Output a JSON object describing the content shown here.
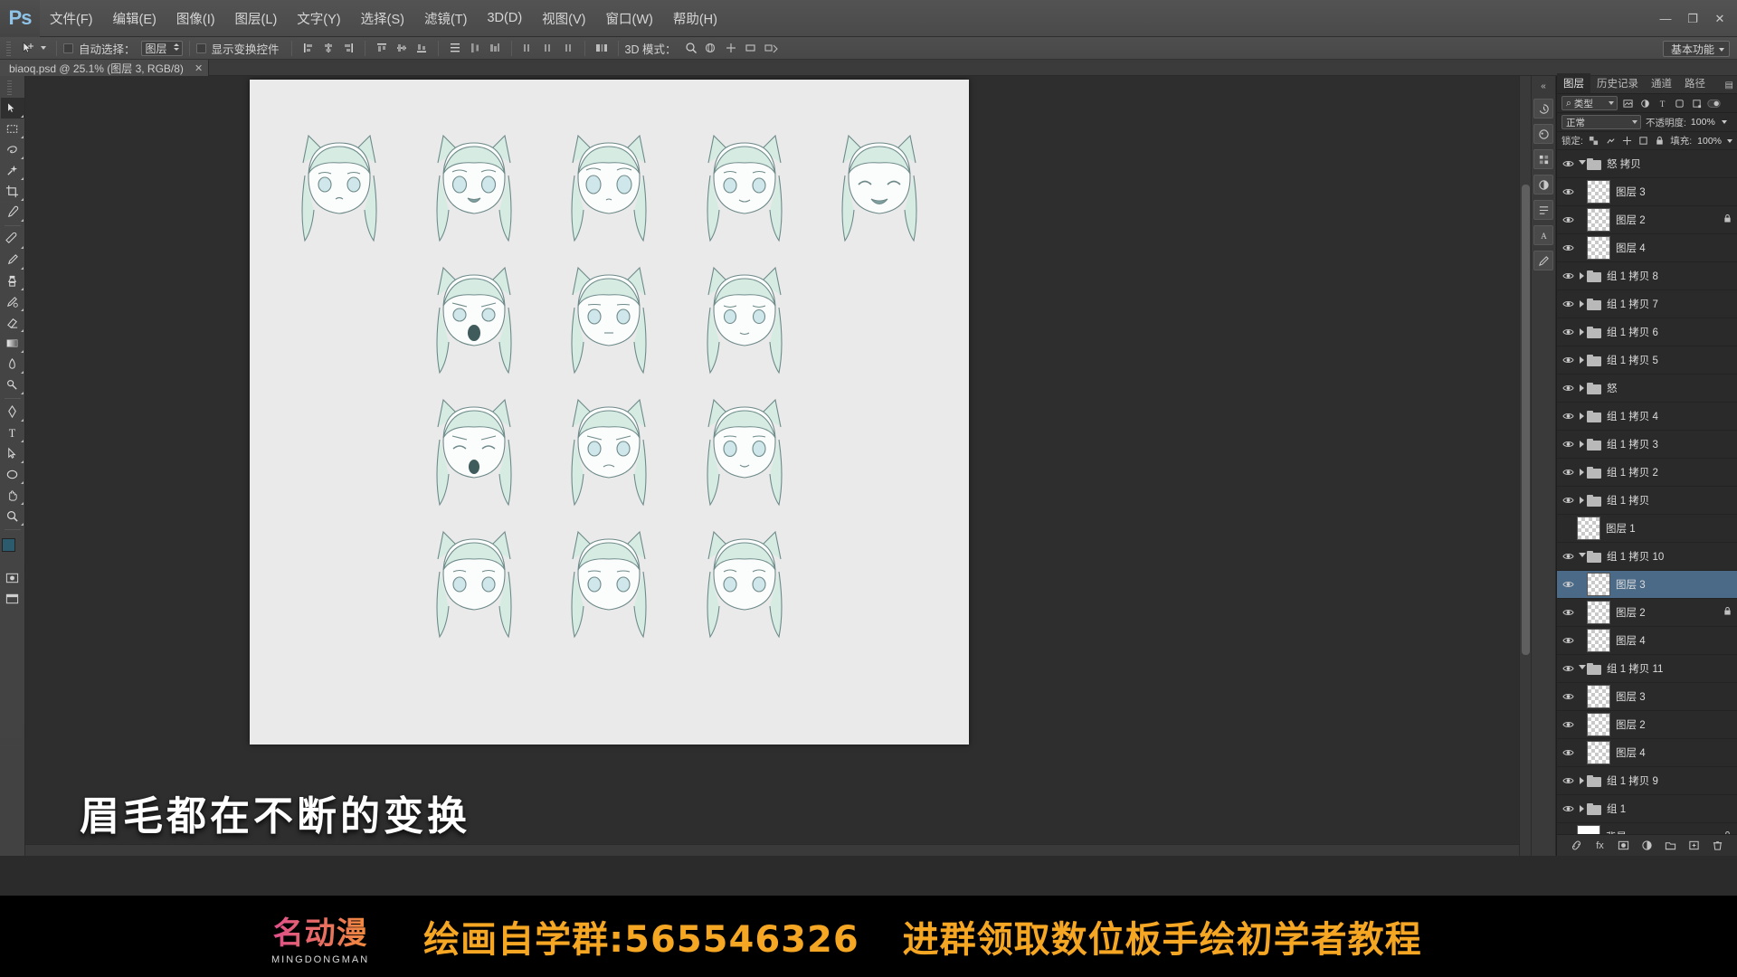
{
  "app": {
    "name": "Ps",
    "logo_text": "Ps"
  },
  "menubar": {
    "items": [
      {
        "label": "文件(F)"
      },
      {
        "label": "编辑(E)"
      },
      {
        "label": "图像(I)"
      },
      {
        "label": "图层(L)"
      },
      {
        "label": "文字(Y)"
      },
      {
        "label": "选择(S)"
      },
      {
        "label": "滤镜(T)"
      },
      {
        "label": "3D(D)"
      },
      {
        "label": "视图(V)"
      },
      {
        "label": "窗口(W)"
      },
      {
        "label": "帮助(H)"
      }
    ],
    "window_controls": {
      "minimize": "—",
      "maximize": "❐",
      "close": "✕"
    }
  },
  "optionsbar": {
    "auto_select_label": "自动选择：",
    "auto_select_value": "图层",
    "show_transform_label": "显示变换控件",
    "mode_3d_label": "3D 模式：",
    "workspace": "基本功能"
  },
  "document": {
    "tab_title": "biaoq.psd @ 25.1% (图层 3, RGB/8)",
    "close_glyph": "✕",
    "zoom": "25.1%",
    "color_mode": "RGB/8",
    "active_layer": "图层 3"
  },
  "tools": {
    "items": [
      {
        "name": "move-tool",
        "glyph": "move",
        "active": false
      },
      {
        "name": "marquee-tool",
        "glyph": "marquee",
        "active": false
      },
      {
        "name": "lasso-tool",
        "glyph": "lasso",
        "active": false
      },
      {
        "name": "quick-selection-tool",
        "glyph": "wand",
        "active": false
      },
      {
        "name": "crop-tool",
        "glyph": "crop",
        "active": false
      },
      {
        "name": "eyedropper-tool",
        "glyph": "eyedropper",
        "active": false
      },
      {
        "name": "healing-brush-tool",
        "glyph": "heal",
        "active": false
      },
      {
        "name": "brush-tool",
        "glyph": "brush",
        "active": false
      },
      {
        "name": "clone-stamp-tool",
        "glyph": "stamp",
        "active": false
      },
      {
        "name": "history-brush-tool",
        "glyph": "history",
        "active": false
      },
      {
        "name": "eraser-tool",
        "glyph": "eraser",
        "active": false
      },
      {
        "name": "gradient-tool",
        "glyph": "gradient",
        "active": false
      },
      {
        "name": "blur-tool",
        "glyph": "blur",
        "active": false
      },
      {
        "name": "dodge-tool",
        "glyph": "dodge",
        "active": false
      },
      {
        "name": "pen-tool",
        "glyph": "pen",
        "active": false
      },
      {
        "name": "type-tool",
        "glyph": "T",
        "active": false
      },
      {
        "name": "path-selection-tool",
        "glyph": "pathsel",
        "active": false
      },
      {
        "name": "ellipse-tool",
        "glyph": "shape",
        "active": false
      },
      {
        "name": "hand-tool",
        "glyph": "hand",
        "active": false
      },
      {
        "name": "zoom-tool",
        "glyph": "zoom",
        "active": false
      }
    ],
    "foreground_color": "#2d5b6e",
    "background_color": "#e9e9e9"
  },
  "panels": {
    "tabs": [
      {
        "label": "图层",
        "active": true
      },
      {
        "label": "历史记录",
        "active": false
      },
      {
        "label": "通道",
        "active": false
      },
      {
        "label": "路径",
        "active": false
      }
    ],
    "menu_glyph": "▤",
    "filter": {
      "type_label": "类型",
      "search_glyph": "⌕"
    },
    "blend_mode": "正常",
    "opacity_label": "不透明度:",
    "opacity_value": "100%",
    "lock_label": "锁定:",
    "fill_label": "填充:",
    "fill_value": "100%"
  },
  "layers": [
    {
      "name": "怒 拷贝",
      "kind": "group",
      "visible": true,
      "expanded": true,
      "indent": 0,
      "locked": false,
      "selected": false
    },
    {
      "name": "图层 3",
      "kind": "pixel",
      "visible": true,
      "expanded": false,
      "indent": 1,
      "locked": false,
      "selected": false
    },
    {
      "name": "图层 2",
      "kind": "pixel",
      "visible": true,
      "expanded": false,
      "indent": 1,
      "locked": true,
      "selected": false
    },
    {
      "name": "图层 4",
      "kind": "pixel",
      "visible": true,
      "expanded": false,
      "indent": 1,
      "locked": false,
      "selected": false
    },
    {
      "name": "组 1 拷贝 8",
      "kind": "group",
      "visible": true,
      "expanded": false,
      "indent": 0,
      "locked": false,
      "selected": false
    },
    {
      "name": "组 1 拷贝 7",
      "kind": "group",
      "visible": true,
      "expanded": false,
      "indent": 0,
      "locked": false,
      "selected": false
    },
    {
      "name": "组 1 拷贝 6",
      "kind": "group",
      "visible": true,
      "expanded": false,
      "indent": 0,
      "locked": false,
      "selected": false
    },
    {
      "name": "组 1 拷贝 5",
      "kind": "group",
      "visible": true,
      "expanded": false,
      "indent": 0,
      "locked": false,
      "selected": false
    },
    {
      "name": "怒",
      "kind": "group",
      "visible": true,
      "expanded": false,
      "indent": 0,
      "locked": false,
      "selected": false
    },
    {
      "name": "组 1 拷贝 4",
      "kind": "group",
      "visible": true,
      "expanded": false,
      "indent": 0,
      "locked": false,
      "selected": false
    },
    {
      "name": "组 1 拷贝 3",
      "kind": "group",
      "visible": true,
      "expanded": false,
      "indent": 0,
      "locked": false,
      "selected": false
    },
    {
      "name": "组 1 拷贝 2",
      "kind": "group",
      "visible": true,
      "expanded": false,
      "indent": 0,
      "locked": false,
      "selected": false
    },
    {
      "name": "组 1 拷贝",
      "kind": "group",
      "visible": true,
      "expanded": false,
      "indent": 0,
      "locked": false,
      "selected": false
    },
    {
      "name": "图层 1",
      "kind": "pixel",
      "visible": false,
      "expanded": false,
      "indent": 0,
      "locked": false,
      "selected": false
    },
    {
      "name": "组 1 拷贝 10",
      "kind": "group",
      "visible": true,
      "expanded": true,
      "indent": 0,
      "locked": false,
      "selected": false
    },
    {
      "name": "图层 3",
      "kind": "pixel",
      "visible": true,
      "expanded": false,
      "indent": 1,
      "locked": false,
      "selected": true
    },
    {
      "name": "图层 2",
      "kind": "pixel",
      "visible": true,
      "expanded": false,
      "indent": 1,
      "locked": true,
      "selected": false
    },
    {
      "name": "图层 4",
      "kind": "pixel",
      "visible": true,
      "expanded": false,
      "indent": 1,
      "locked": false,
      "selected": false
    },
    {
      "name": "组 1 拷贝 11",
      "kind": "group",
      "visible": true,
      "expanded": true,
      "indent": 0,
      "locked": false,
      "selected": false
    },
    {
      "name": "图层 3",
      "kind": "pixel",
      "visible": true,
      "expanded": false,
      "indent": 1,
      "locked": false,
      "selected": false
    },
    {
      "name": "图层 2",
      "kind": "pixel",
      "visible": true,
      "expanded": false,
      "indent": 1,
      "locked": false,
      "selected": false
    },
    {
      "name": "图层 4",
      "kind": "pixel",
      "visible": true,
      "expanded": false,
      "indent": 1,
      "locked": false,
      "selected": false
    },
    {
      "name": "组 1 拷贝 9",
      "kind": "group",
      "visible": true,
      "expanded": false,
      "indent": 0,
      "locked": false,
      "selected": false
    },
    {
      "name": "组 1",
      "kind": "group",
      "visible": true,
      "expanded": false,
      "indent": 0,
      "locked": false,
      "selected": false
    },
    {
      "name": "背景",
      "kind": "white",
      "visible": true,
      "expanded": false,
      "indent": 0,
      "locked": true,
      "selected": false
    }
  ],
  "panel_footer": {
    "link_glyph": "⛓",
    "fx_glyph": "fx",
    "mask_glyph": "◑",
    "adjust_glyph": "◐",
    "group_glyph": "▭",
    "new_glyph": "⊞",
    "delete_glyph": "🗑"
  },
  "subtitle": {
    "text": "眉毛都在不断的变换"
  },
  "banner": {
    "logo_main": "名动漫",
    "logo_sub": "MINGDONGMAN",
    "text_left": "绘画自学群:565546326",
    "text_right": "进群领取数位板手绘初学者教程",
    "accent_color": "#f5a623",
    "logo_color": "#e0508a",
    "background": "#000000"
  },
  "artwork": {
    "description": "猫耳少女表情练习线稿",
    "paper_color": "#eaeaea",
    "line_color": "#5f7a7a",
    "hair_color": "#cfe8de",
    "rows": 4,
    "columns": 5,
    "faces": [
      {
        "row": 1,
        "col": 1,
        "expr": "neutral"
      },
      {
        "row": 1,
        "col": 2,
        "expr": "smile-open"
      },
      {
        "row": 1,
        "col": 3,
        "expr": "wide-eyes"
      },
      {
        "row": 1,
        "col": 4,
        "expr": "calm"
      },
      {
        "row": 1,
        "col": 5,
        "expr": "laugh-closed-eyes"
      },
      {
        "row": 2,
        "col": 2,
        "expr": "shout"
      },
      {
        "row": 2,
        "col": 3,
        "expr": "blank"
      },
      {
        "row": 2,
        "col": 4,
        "expr": "shy"
      },
      {
        "row": 3,
        "col": 2,
        "expr": "cry"
      },
      {
        "row": 3,
        "col": 3,
        "expr": "worried"
      },
      {
        "row": 3,
        "col": 4,
        "expr": "sad-smile"
      },
      {
        "row": 4,
        "col": 2,
        "expr": "partial"
      },
      {
        "row": 4,
        "col": 3,
        "expr": "partial"
      },
      {
        "row": 4,
        "col": 4,
        "expr": "partial"
      }
    ]
  }
}
